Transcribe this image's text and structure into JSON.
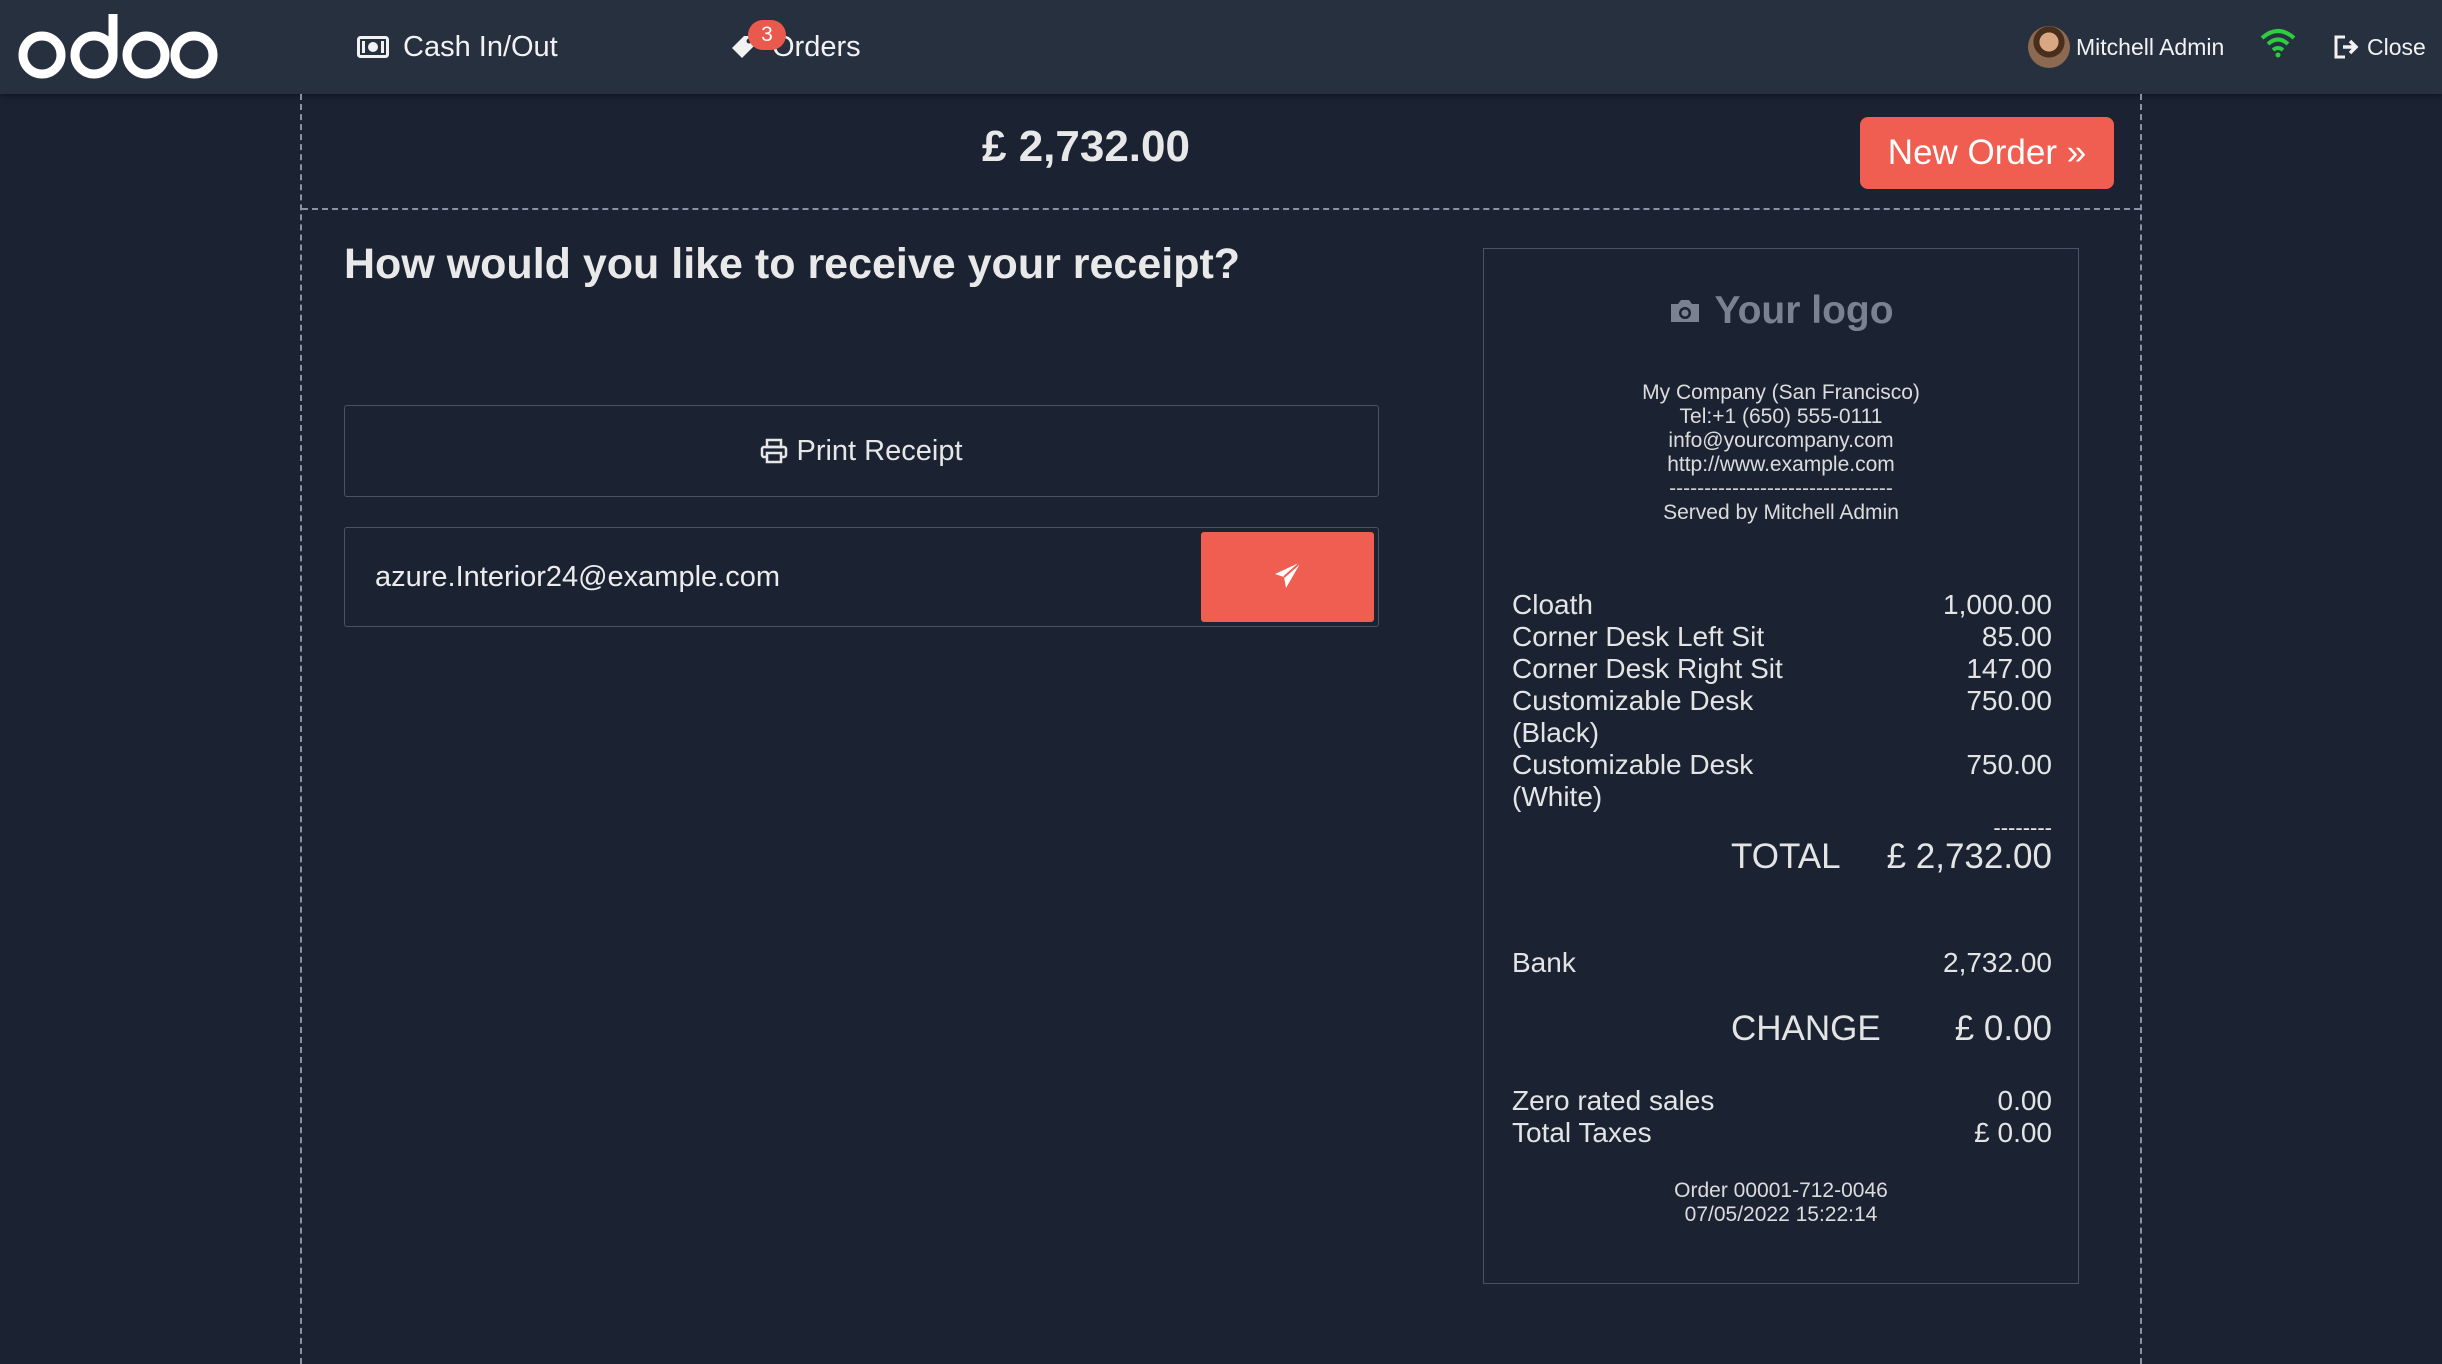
{
  "header": {
    "brand": "odoo",
    "cash_label": "Cash In/Out",
    "orders_label": "Orders",
    "orders_badge": "3",
    "user_name": "Mitchell Admin",
    "close_label": "Close",
    "icons": [
      "money-icon",
      "tag-icon",
      "wifi-icon",
      "sign-out-icon"
    ],
    "wifi_color": "#2ecc40",
    "accent_color": "#ef5e50"
  },
  "payment": {
    "total": "£ 2,732.00",
    "new_order_label": "New Order »"
  },
  "receipt_options": {
    "question": "How would you like to receive your receipt?",
    "print_label": "Print Receipt",
    "email_value": "azure.Interior24@example.com"
  },
  "receipt": {
    "logo_text": "Your logo",
    "company": "My Company (San Francisco)",
    "tel": "Tel:+1 (650) 555-0111",
    "email": "info@yourcompany.com",
    "website": "http://www.example.com",
    "separator": "--------------------------------",
    "served_by": "Served by Mitchell Admin",
    "lines": [
      {
        "name": "Cloath",
        "price": "1,000.00"
      },
      {
        "name": "Corner Desk Left Sit",
        "price": "85.00"
      },
      {
        "name": "Corner Desk Right Sit",
        "price": "147.00"
      },
      {
        "name": "Customizable Desk (Black)",
        "price": "750.00"
      },
      {
        "name": "Customizable Desk (White)",
        "price": "750.00"
      }
    ],
    "dashes": "--------",
    "total_label": "TOTAL",
    "total_value": "£ 2,732.00",
    "payment_method": "Bank",
    "payment_amount": "2,732.00",
    "change_label": "CHANGE",
    "change_value": "£ 0.00",
    "zero_rated_label": "Zero rated sales",
    "zero_rated_value": "0.00",
    "total_taxes_label": "Total Taxes",
    "total_taxes_value": "£ 0.00",
    "order_ref": "Order 00001-712-0046",
    "order_date": "07/05/2022 15:22:14"
  }
}
